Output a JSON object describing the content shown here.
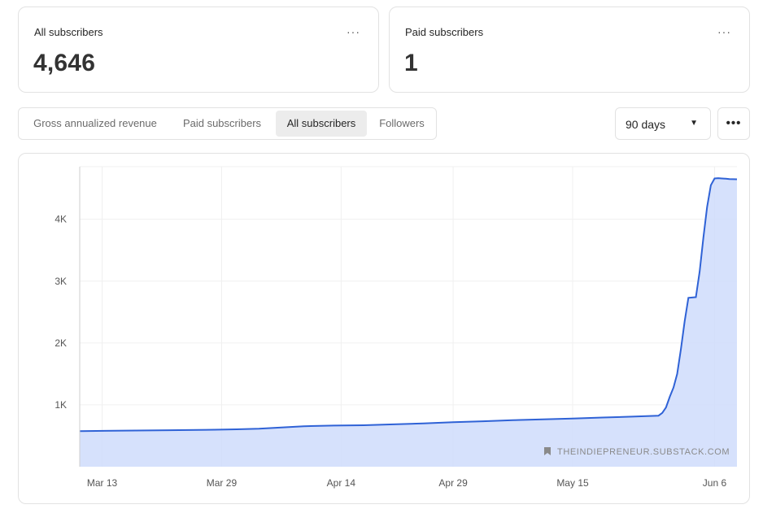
{
  "cards": [
    {
      "label": "All subscribers",
      "value": "4,646",
      "more": "···"
    },
    {
      "label": "Paid subscribers",
      "value": "1",
      "more": "···"
    }
  ],
  "tabs": [
    {
      "label": "Gross annualized revenue",
      "active": false
    },
    {
      "label": "Paid subscribers",
      "active": false
    },
    {
      "label": "All subscribers",
      "active": true
    },
    {
      "label": "Followers",
      "active": false
    }
  ],
  "range": {
    "label": "90 days",
    "caret": "▼"
  },
  "more_button": "•••",
  "watermark": "THEINDIEPRENEUR.SUBSTACK.COM",
  "colors": {
    "line": "#2f62d6",
    "fill": "#cfdcfb",
    "grid": "#f0f0f0",
    "tick": "#555555"
  },
  "chart_data": {
    "type": "area",
    "x_ticks": [
      "Mar 13",
      "Mar 29",
      "Apr 14",
      "Apr 29",
      "May 15",
      "Jun 6"
    ],
    "x_tick_days": [
      3,
      19,
      35,
      50,
      66,
      85
    ],
    "y_ticks": [
      "1K",
      "2K",
      "3K",
      "4K"
    ],
    "y_tick_values": [
      1000,
      2000,
      3000,
      4000
    ],
    "xlim": [
      0,
      88
    ],
    "ylim": [
      0,
      4850
    ],
    "grid": true,
    "x": [
      0,
      6,
      12,
      18,
      21,
      24,
      27,
      30,
      34,
      38,
      42,
      46,
      50,
      54,
      58,
      62,
      66,
      70,
      74,
      77.5,
      78,
      78.5,
      79,
      79.5,
      80,
      80.5,
      81,
      81.5,
      82,
      82.5,
      83,
      83.5,
      84,
      84.5,
      85,
      85.5,
      86,
      86.5,
      87,
      88
    ],
    "values": [
      576,
      583,
      590,
      598,
      605,
      615,
      635,
      655,
      665,
      670,
      685,
      700,
      720,
      735,
      752,
      765,
      780,
      795,
      810,
      825,
      870,
      960,
      1130,
      1280,
      1500,
      1900,
      2350,
      2730,
      2735,
      2740,
      3150,
      3700,
      4200,
      4550,
      4660,
      4665,
      4660,
      4655,
      4650,
      4646
    ]
  }
}
